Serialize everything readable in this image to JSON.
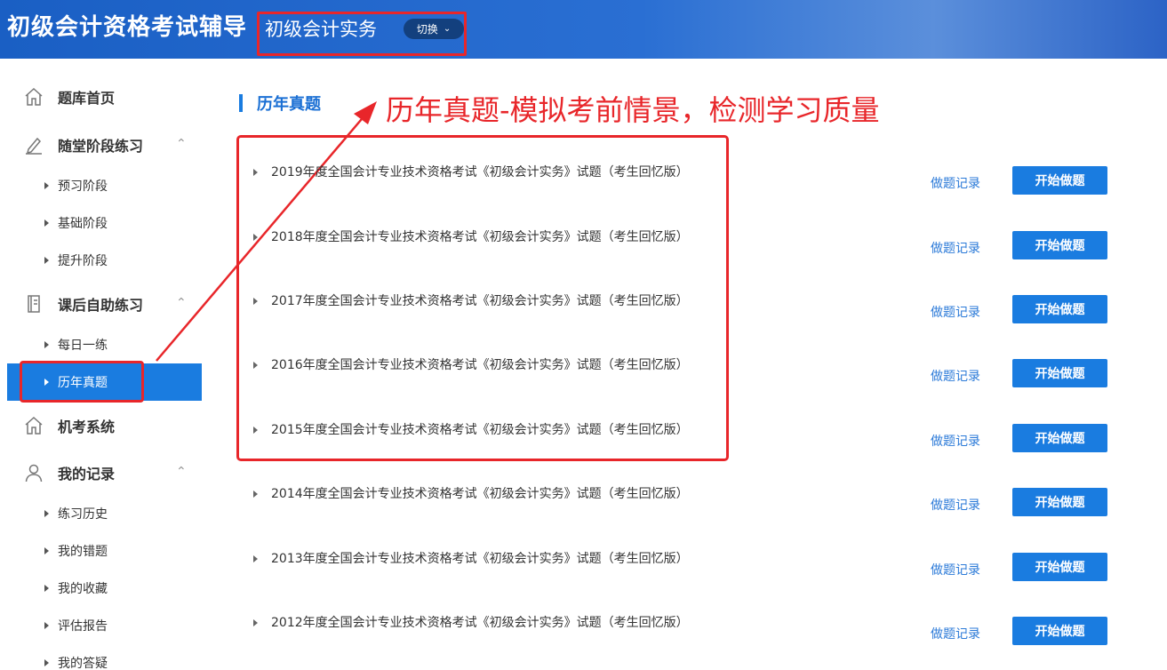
{
  "header": {
    "app_title": "初级会计资格考试辅导",
    "subject": "初级会计实务",
    "switch_label": "切换"
  },
  "sidebar": {
    "home": "题库首页",
    "stage_practice": "随堂阶段练习",
    "preview": "预习阶段",
    "basic": "基础阶段",
    "advance": "提升阶段",
    "after_class": "课后自助练习",
    "daily": "每日一练",
    "past_papers": "历年真题",
    "exam_system": "机考系统",
    "my_records": "我的记录",
    "history": "练习历史",
    "wrong": "我的错题",
    "favorites": "我的收藏",
    "report": "评估报告",
    "questions": "我的答疑"
  },
  "main": {
    "section_title": "历年真题",
    "annotation": "历年真题-模拟考前情景，检测学习质量",
    "record_label": "做题记录",
    "start_label": "开始做题",
    "papers": [
      "2019年度全国会计专业技术资格考试《初级会计实务》试题（考生回忆版）",
      "2018年度全国会计专业技术资格考试《初级会计实务》试题（考生回忆版）",
      "2017年度全国会计专业技术资格考试《初级会计实务》试题（考生回忆版）",
      "2016年度全国会计专业技术资格考试《初级会计实务》试题（考生回忆版）",
      "2015年度全国会计专业技术资格考试《初级会计实务》试题（考生回忆版）",
      "2014年度全国会计专业技术资格考试《初级会计实务》试题（考生回忆版）",
      "2013年度全国会计专业技术资格考试《初级会计实务》试题（考生回忆版）",
      "2012年度全国会计专业技术资格考试《初级会计实务》试题（考生回忆版）"
    ]
  },
  "colors": {
    "accent": "#1a7ce0",
    "annotation_red": "#e8262a",
    "header_blue": "#1a5fc4"
  }
}
